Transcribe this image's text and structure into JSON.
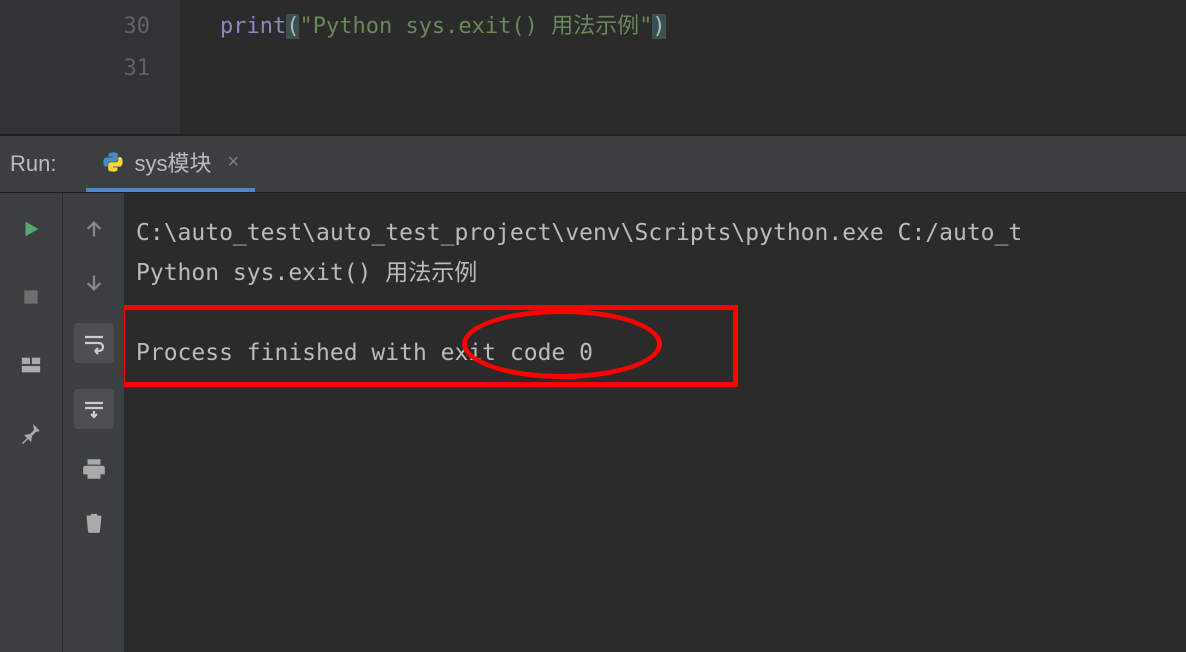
{
  "editor": {
    "lines": [
      {
        "num": "30",
        "fn": "print",
        "lp": "(",
        "str": "\"Python sys.exit() 用法示例\"",
        "rp": ")"
      },
      {
        "num": "31",
        "fn": "",
        "lp": "",
        "str": "",
        "rp": ""
      }
    ]
  },
  "run": {
    "label": "Run:",
    "tab_name": "sys模块",
    "close_symbol": "×"
  },
  "console": {
    "line1": "C:\\auto_test\\auto_test_project\\venv\\Scripts\\python.exe C:/auto_t",
    "line2": "Python sys.exit() 用法示例",
    "line3": " ",
    "line4": "Process finished with exit code 0"
  },
  "icons": {
    "run": "run-icon",
    "stop": "stop-icon",
    "layout": "layout-icon",
    "pin": "pin-icon",
    "up": "up-arrow-icon",
    "down": "down-arrow-icon",
    "wrap": "wrap-icon",
    "scroll": "scroll-end-icon",
    "print": "print-icon",
    "trash": "trash-icon"
  },
  "colors": {
    "bg": "#2b2b2b",
    "panel": "#3c3f41",
    "accent": "#4a88c7",
    "run_green": "#59a869",
    "annotation": "#ff0000"
  }
}
